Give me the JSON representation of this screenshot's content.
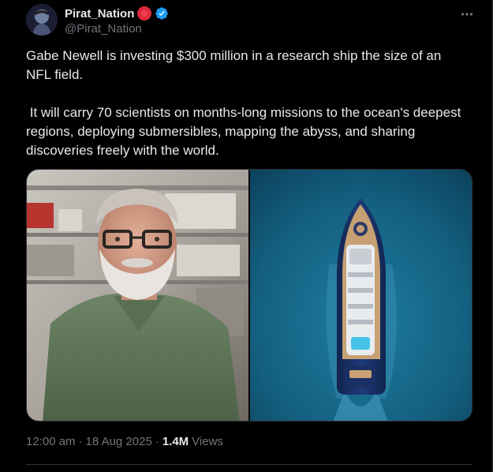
{
  "author": {
    "display_name": "Pirat_Nation",
    "handle": "@Pirat_Nation",
    "badge_color": "#dd2a3b",
    "verified_color": "#1d9bf0",
    "avatar_icon": "avatar-image"
  },
  "menu": {
    "icon": "more-horizontal-icon"
  },
  "tweet": {
    "paragraph_1": "Gabe Newell is investing $300 million in a research ship the size of an NFL field.",
    "paragraph_2": " It will carry 70 scientists on months-long missions to the ocean's deepest regions, deploying submersibles, mapping the abyss, and sharing discoveries freely with the world."
  },
  "media": {
    "images": [
      {
        "icon": "portrait-photo"
      },
      {
        "icon": "ship-aerial-photo"
      }
    ]
  },
  "meta": {
    "time": "12:00 am",
    "separator_1": "·",
    "date": "18 Aug 2025",
    "separator_2": "·",
    "views_count": "1.4M",
    "views_label": "Views"
  },
  "colors": {
    "background": "#000000",
    "text": "#e7e9ea",
    "secondary_text": "#71767b",
    "border": "#2f3336"
  }
}
